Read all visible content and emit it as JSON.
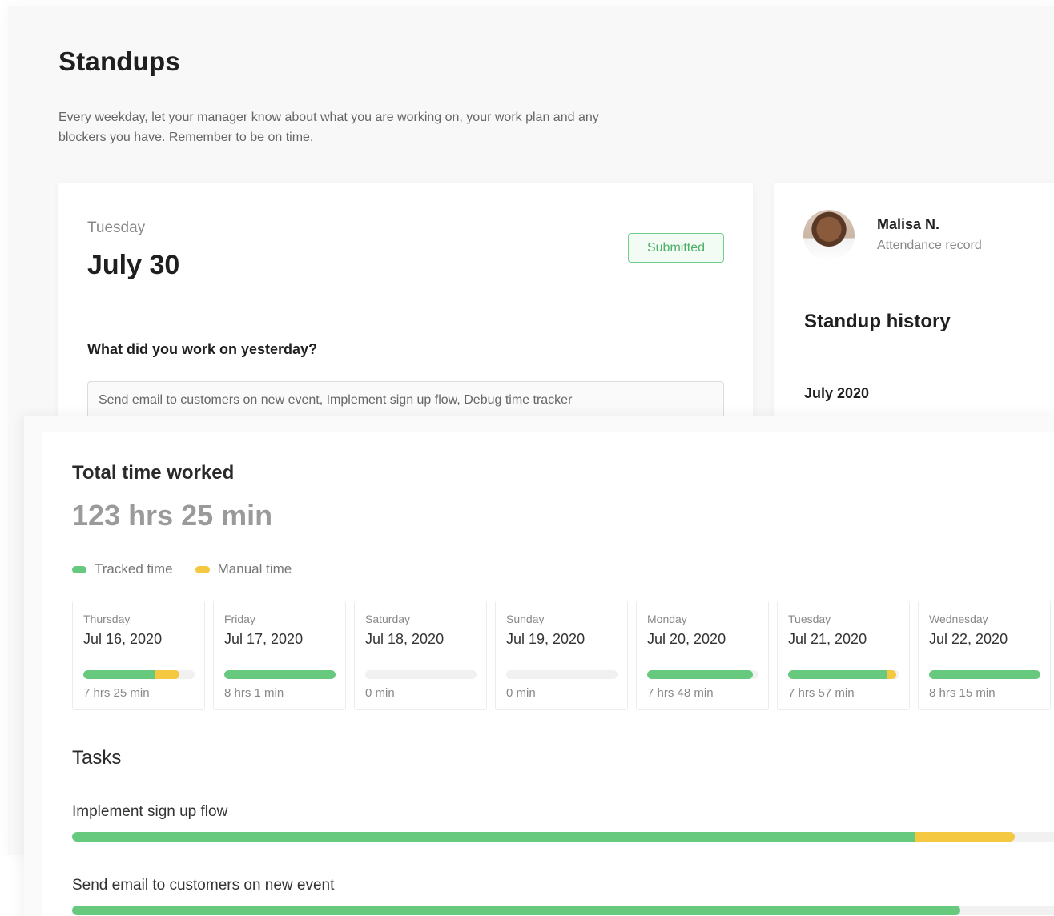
{
  "standups": {
    "title": "Standups",
    "description": "Every weekday, let your manager know about what you are working on, your work plan and any blockers you have. Remember to be on time.",
    "card": {
      "day": "Tuesday",
      "date": "July 30",
      "status": "Submitted",
      "question": "What did you work on yesterday?",
      "answer": "Send email to customers on new event, Implement sign up flow, Debug time tracker"
    },
    "history": {
      "user_name": "Malisa N.",
      "user_sub": "Attendance record",
      "title": "Standup history",
      "month": "July 2020"
    }
  },
  "time_worked": {
    "title": "Total time worked",
    "total": "123 hrs 25 min",
    "legend": [
      {
        "label": "Tracked time",
        "color": "#66c97d"
      },
      {
        "label": "Manual time",
        "color": "#f5c842"
      }
    ],
    "days": [
      {
        "day": "Thursday",
        "date": "Jul 16, 2020",
        "hours": "7 hrs 25 min",
        "tracked": 0.64,
        "manual": 0.22
      },
      {
        "day": "Friday",
        "date": "Jul 17, 2020",
        "hours": "8 hrs 1 min",
        "tracked": 1.0,
        "manual": 0
      },
      {
        "day": "Saturday",
        "date": "Jul 18, 2020",
        "hours": "0 min",
        "tracked": 0,
        "manual": 0
      },
      {
        "day": "Sunday",
        "date": "Jul 19, 2020",
        "hours": "0 min",
        "tracked": 0,
        "manual": 0
      },
      {
        "day": "Monday",
        "date": "Jul 20, 2020",
        "hours": "7 hrs 48 min",
        "tracked": 0.95,
        "manual": 0
      },
      {
        "day": "Tuesday",
        "date": "Jul 21, 2020",
        "hours": "7 hrs 57 min",
        "tracked": 0.89,
        "manual": 0.08
      },
      {
        "day": "Wednesday",
        "date": "Jul 22, 2020",
        "hours": "8 hrs 15 min",
        "tracked": 1.0,
        "manual": 0
      }
    ],
    "tasks_title": "Tasks",
    "tasks": [
      {
        "name": "Implement sign up flow",
        "tracked": 0.855,
        "manual": 0.1
      },
      {
        "name": "Send email to customers on new event",
        "tracked": 0.9,
        "manual": 0
      }
    ]
  }
}
